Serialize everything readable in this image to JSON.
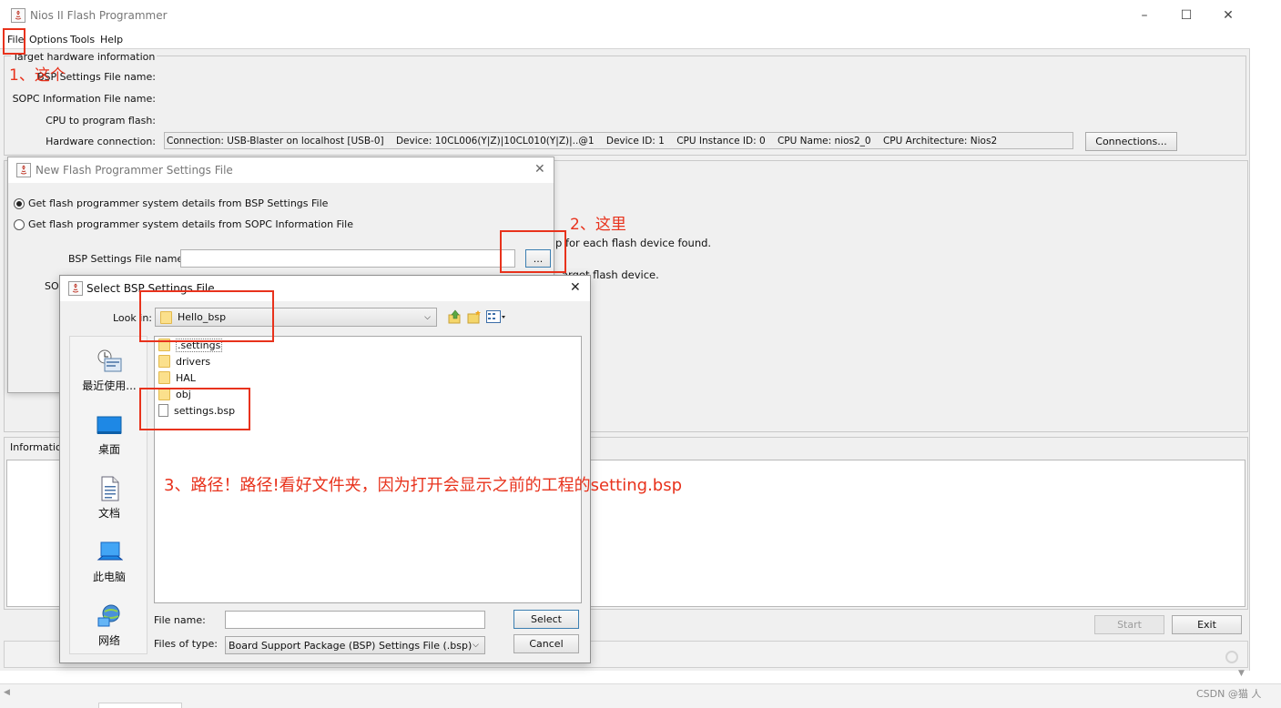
{
  "main_window": {
    "title": "Nios II Flash Programmer",
    "menu": [
      "File",
      "Options",
      "Tools",
      "Help"
    ],
    "target_section_title": "Target hardware information",
    "labels": {
      "bsp_file": "BSP Settings File name:",
      "sopc_file": "SOPC Information File name:",
      "cpu": "CPU to program flash:",
      "hw_connection": "Hardware connection:"
    },
    "hw_connection_value": "Connection: USB-Blaster on localhost [USB-0]    Device: 10CL006(Y|Z)|10CL010(Y|Z)|..@1    Device ID: 1    CPU Instance ID: 0    CPU Name: nios2_0    CPU Architecture: Nios2",
    "connections_button": "Connections...",
    "info_line1_tail": "p for each flash device found.",
    "info_line2_tail": "arget flash device.",
    "information_label": "Information",
    "start_button": "Start",
    "exit_button": "Exit"
  },
  "settings_dialog": {
    "title": "New Flash Programmer Settings File",
    "radio1": "Get flash programmer system details from BSP Settings File",
    "radio2": "Get flash programmer system details from SOPC Information File",
    "bsp_label": "BSP Settings File name:",
    "bsp_value": "",
    "browse_button": "...",
    "partial_label": "SOF"
  },
  "select_dialog": {
    "title": "Select BSP Settings File",
    "look_in_label": "Look in:",
    "look_in_value": "Hello_bsp",
    "places": [
      "最近使用...",
      "桌面",
      "文档",
      "此电脑",
      "网络"
    ],
    "files": [
      {
        "name": ".settings",
        "type": "folder"
      },
      {
        "name": "drivers",
        "type": "folder"
      },
      {
        "name": "HAL",
        "type": "folder"
      },
      {
        "name": "obj",
        "type": "folder"
      },
      {
        "name": "settings.bsp",
        "type": "file"
      }
    ],
    "file_name_label": "File name:",
    "file_name_value": "",
    "files_of_type_label": "Files of type:",
    "files_of_type_value": "Board Support Package (BSP) Settings File (.bsp)",
    "select_button": "Select",
    "cancel_button": "Cancel"
  },
  "annotations": {
    "note1": "1、这个",
    "note2": "2、这里",
    "note3": "3、路径！路径!看好文件夹，因为打开会显示之前的工程的setting.bsp"
  },
  "watermark": "CSDN @猫 人",
  "colors": {
    "annotation_red": "#e8321c",
    "window_bg": "#f0f0f0",
    "select_button_border": "#3c7fb1"
  }
}
